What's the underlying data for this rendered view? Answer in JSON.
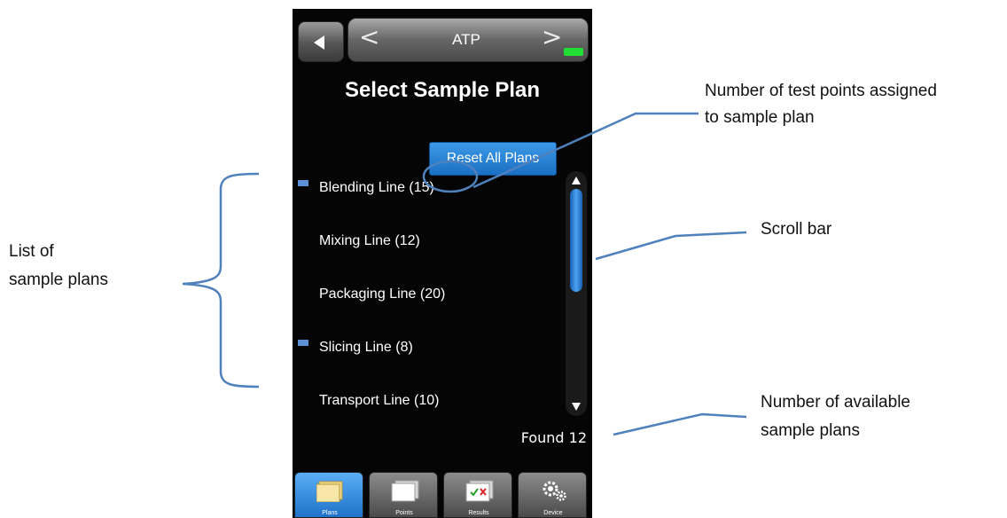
{
  "header": {
    "back_icon": "back-triangle-icon",
    "prev_symbol": "<",
    "next_symbol": ">",
    "mode_title": "ATP",
    "battery_color": "#22dd33"
  },
  "page": {
    "title": "Select Sample Plan",
    "reset_label": "Reset All Plans"
  },
  "plans": [
    {
      "label": "Blending Line (15)",
      "marked": true
    },
    {
      "label": "Mixing Line (12)",
      "marked": false
    },
    {
      "label": "Packaging Line (20)",
      "marked": false
    },
    {
      "label": "Slicing Line (8)",
      "marked": true
    },
    {
      "label": "Transport Line (10)",
      "marked": false
    }
  ],
  "scrollbar": {
    "position_fraction": 0.0,
    "visible_fraction": 0.42
  },
  "found": "Found 12",
  "tabs": [
    {
      "label": "Plans",
      "icon": "folders-icon",
      "active": true
    },
    {
      "label": "Points",
      "icon": "pages-icon",
      "active": false
    },
    {
      "label": "Results",
      "icon": "results-check-cross-icon",
      "active": false
    },
    {
      "label": "Device",
      "icon": "gears-icon",
      "active": false
    }
  ],
  "annotations": {
    "test_points_line1": "Number of test points assigned",
    "test_points_line2": "to sample plan",
    "scroll_bar": "Scroll bar",
    "list_line1": "List of",
    "list_line2": "sample plans",
    "available_line1": "Number of available",
    "available_line2": "sample plans"
  },
  "colors": {
    "accent_blue": "#1a6fc3",
    "marker_blue": "#5b8fd6",
    "annotation_line": "#4f81bd"
  }
}
